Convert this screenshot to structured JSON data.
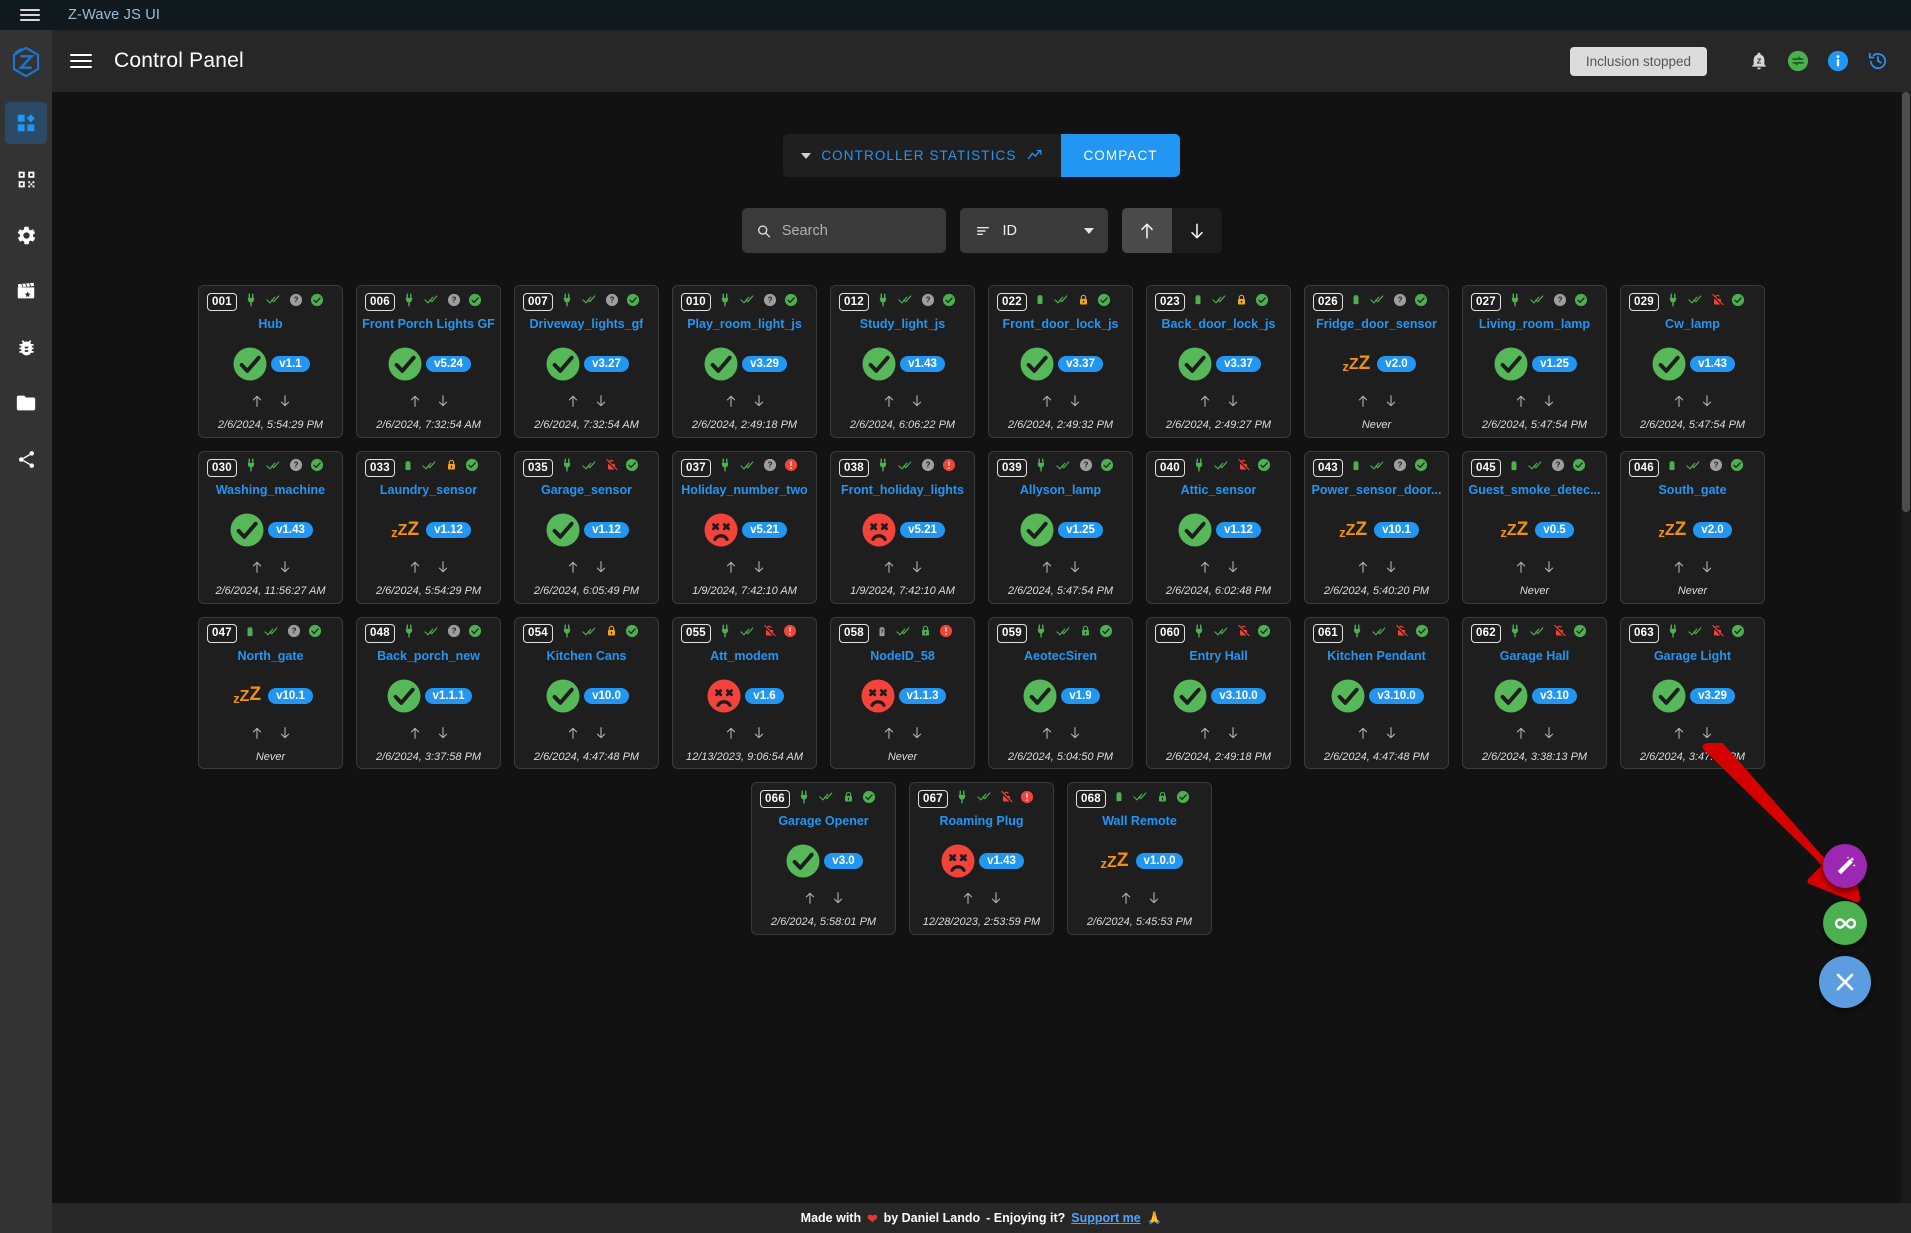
{
  "os_bar": {
    "title": "Z-Wave JS UI",
    "menu_icon": "hamburger-icon"
  },
  "appbar": {
    "title": "Control Panel",
    "inclusion_chip": "Inclusion stopped",
    "icons": [
      "zwave-bell-icon",
      "sync-icon",
      "info-icon",
      "history-icon"
    ]
  },
  "sidebar": {
    "items": [
      {
        "name": "dashboard",
        "icon": "dashboard-icon",
        "active": true
      },
      {
        "name": "qrcode",
        "icon": "qrcode-icon",
        "active": false
      },
      {
        "name": "settings",
        "icon": "gear-icon",
        "active": false
      },
      {
        "name": "scenes",
        "icon": "clapperboard-icon",
        "active": false
      },
      {
        "name": "debug",
        "icon": "bug-icon",
        "active": false
      },
      {
        "name": "store",
        "icon": "folder-icon",
        "active": false
      },
      {
        "name": "network",
        "icon": "share-icon",
        "active": false
      }
    ]
  },
  "toolbar": {
    "stats_label": "CONTROLLER STATISTICS",
    "stats_chart_icon": "trend-chart-icon",
    "compact_label": "COMPACT",
    "compact_active": true
  },
  "search": {
    "placeholder": "Search",
    "value": "",
    "icon": "search-icon",
    "sort_label": "ID",
    "sort_icon": "sort-icon",
    "asc_icon": "arrow-up-icon",
    "desc_icon": "arrow-down-icon",
    "direction_selected": "asc"
  },
  "fabs": [
    {
      "name": "magic-wand-fab",
      "icon": "magic-wand-icon",
      "color": "#9c27b0"
    },
    {
      "name": "infinity-fab",
      "icon": "infinity-icon",
      "color": "#4caf50"
    },
    {
      "name": "close-fab",
      "icon": "close-icon",
      "color": "#5c9ce0"
    }
  ],
  "annotation": {
    "name": "red-arrow-pointer",
    "color": "#d50000",
    "points_to": "infinity-fab"
  },
  "footer": {
    "made_with": "Made with",
    "heart": "❤",
    "by": "by Daniel Lando",
    "enjoying": "- Enjoying it?",
    "support_link": "Support me",
    "pray": "🙏"
  },
  "colors": {
    "accent": "#2196f3",
    "ok": "#4caf50",
    "dead": "#f44336",
    "sleep": "#f29111",
    "warn_lock": "#f5a623",
    "unknown": "#9e9e9e",
    "card_bg": "#1e1e1e",
    "page_bg": "#121212"
  },
  "nodes": [
    {
      "id": "001",
      "name": "Hub",
      "power": "plug",
      "power_color": "#4caf50",
      "ready": "double-check",
      "lock": "question",
      "lock_color": "#9e9e9e",
      "health": "check-circle",
      "health_color": "#4caf50",
      "status": "ok",
      "version": "v1.1",
      "last_seen": "2/6/2024, 5:54:29 PM"
    },
    {
      "id": "006",
      "name": "Front Porch Lights GF",
      "power": "plug",
      "power_color": "#4caf50",
      "ready": "double-check",
      "lock": "question",
      "lock_color": "#9e9e9e",
      "health": "check-circle",
      "health_color": "#4caf50",
      "status": "ok",
      "version": "v5.24",
      "last_seen": "2/6/2024, 7:32:54 AM"
    },
    {
      "id": "007",
      "name": "Driveway_lights_gf",
      "power": "plug",
      "power_color": "#4caf50",
      "ready": "double-check",
      "lock": "question",
      "lock_color": "#9e9e9e",
      "health": "check-circle",
      "health_color": "#4caf50",
      "status": "ok",
      "version": "v3.27",
      "last_seen": "2/6/2024, 7:32:54 AM"
    },
    {
      "id": "010",
      "name": "Play_room_light_js",
      "power": "plug",
      "power_color": "#4caf50",
      "ready": "double-check",
      "lock": "question",
      "lock_color": "#9e9e9e",
      "health": "check-circle",
      "health_color": "#4caf50",
      "status": "ok",
      "version": "v3.29",
      "last_seen": "2/6/2024, 2:49:18 PM"
    },
    {
      "id": "012",
      "name": "Study_light_js",
      "power": "plug",
      "power_color": "#4caf50",
      "ready": "double-check",
      "lock": "question",
      "lock_color": "#9e9e9e",
      "health": "check-circle",
      "health_color": "#4caf50",
      "status": "ok",
      "version": "v1.43",
      "last_seen": "2/6/2024, 6:06:22 PM"
    },
    {
      "id": "022",
      "name": "Front_door_lock_js",
      "power": "battery",
      "power_color": "#4caf50",
      "ready": "double-check",
      "lock": "lock",
      "lock_color": "#f5a623",
      "health": "check-circle",
      "health_color": "#4caf50",
      "status": "ok",
      "version": "v3.37",
      "last_seen": "2/6/2024, 2:49:32 PM"
    },
    {
      "id": "023",
      "name": "Back_door_lock_js",
      "power": "battery",
      "power_color": "#4caf50",
      "ready": "double-check",
      "lock": "lock",
      "lock_color": "#f5a623",
      "health": "check-circle",
      "health_color": "#4caf50",
      "status": "ok",
      "version": "v3.37",
      "last_seen": "2/6/2024, 2:49:27 PM"
    },
    {
      "id": "026",
      "name": "Fridge_door_sensor",
      "power": "battery",
      "power_color": "#4caf50",
      "ready": "double-check",
      "lock": "question",
      "lock_color": "#9e9e9e",
      "health": "check-circle",
      "health_color": "#4caf50",
      "status": "asleep",
      "version": "v2.0",
      "last_seen": "Never"
    },
    {
      "id": "027",
      "name": "Living_room_lamp",
      "power": "plug",
      "power_color": "#4caf50",
      "ready": "double-check",
      "lock": "question",
      "lock_color": "#9e9e9e",
      "health": "check-circle",
      "health_color": "#4caf50",
      "status": "ok",
      "version": "v1.25",
      "last_seen": "2/6/2024, 5:47:54 PM"
    },
    {
      "id": "029",
      "name": "Cw_lamp",
      "power": "plug",
      "power_color": "#4caf50",
      "ready": "double-check",
      "lock": "lock-off",
      "lock_color": "#f44336",
      "health": "check-circle",
      "health_color": "#4caf50",
      "status": "ok",
      "version": "v1.43",
      "last_seen": "2/6/2024, 5:47:54 PM"
    },
    {
      "id": "030",
      "name": "Washing_machine",
      "power": "plug",
      "power_color": "#4caf50",
      "ready": "double-check",
      "lock": "question",
      "lock_color": "#9e9e9e",
      "health": "check-circle",
      "health_color": "#4caf50",
      "status": "ok",
      "version": "v1.43",
      "last_seen": "2/6/2024, 11:56:27 AM"
    },
    {
      "id": "033",
      "name": "Laundry_sensor",
      "power": "battery",
      "power_color": "#4caf50",
      "ready": "double-check",
      "lock": "lock",
      "lock_color": "#f5a623",
      "health": "check-circle",
      "health_color": "#4caf50",
      "status": "asleep",
      "version": "v1.12",
      "last_seen": "2/6/2024, 5:54:29 PM"
    },
    {
      "id": "035",
      "name": "Garage_sensor",
      "power": "plug",
      "power_color": "#4caf50",
      "ready": "double-check",
      "lock": "lock-off",
      "lock_color": "#f44336",
      "health": "check-circle",
      "health_color": "#4caf50",
      "status": "ok",
      "version": "v1.12",
      "last_seen": "2/6/2024, 6:05:49 PM"
    },
    {
      "id": "037",
      "name": "Holiday_number_two",
      "power": "plug",
      "power_color": "#4caf50",
      "ready": "double-check",
      "lock": "question",
      "lock_color": "#9e9e9e",
      "health": "alert-circle",
      "health_color": "#f44336",
      "status": "dead",
      "version": "v5.21",
      "last_seen": "1/9/2024, 7:42:10 AM"
    },
    {
      "id": "038",
      "name": "Front_holiday_lights",
      "power": "plug",
      "power_color": "#4caf50",
      "ready": "double-check",
      "lock": "question",
      "lock_color": "#9e9e9e",
      "health": "alert-circle",
      "health_color": "#f44336",
      "status": "dead",
      "version": "v5.21",
      "last_seen": "1/9/2024, 7:42:10 AM"
    },
    {
      "id": "039",
      "name": "Allyson_lamp",
      "power": "plug",
      "power_color": "#4caf50",
      "ready": "double-check",
      "lock": "question",
      "lock_color": "#9e9e9e",
      "health": "check-circle",
      "health_color": "#4caf50",
      "status": "ok",
      "version": "v1.25",
      "last_seen": "2/6/2024, 5:47:54 PM"
    },
    {
      "id": "040",
      "name": "Attic_sensor",
      "power": "plug",
      "power_color": "#4caf50",
      "ready": "double-check",
      "lock": "lock-off",
      "lock_color": "#f44336",
      "health": "check-circle",
      "health_color": "#4caf50",
      "status": "ok",
      "version": "v1.12",
      "last_seen": "2/6/2024, 6:02:48 PM"
    },
    {
      "id": "043",
      "name": "Power_sensor_door...",
      "power": "battery",
      "power_color": "#4caf50",
      "ready": "double-check",
      "lock": "question",
      "lock_color": "#9e9e9e",
      "health": "check-circle",
      "health_color": "#4caf50",
      "status": "asleep",
      "version": "v10.1",
      "last_seen": "2/6/2024, 5:40:20 PM"
    },
    {
      "id": "045",
      "name": "Guest_smoke_detec...",
      "power": "battery",
      "power_color": "#4caf50",
      "ready": "double-check",
      "lock": "question",
      "lock_color": "#9e9e9e",
      "health": "check-circle",
      "health_color": "#4caf50",
      "status": "asleep",
      "version": "v0.5",
      "last_seen": "Never"
    },
    {
      "id": "046",
      "name": "South_gate",
      "power": "battery",
      "power_color": "#4caf50",
      "ready": "double-check",
      "lock": "question",
      "lock_color": "#9e9e9e",
      "health": "check-circle",
      "health_color": "#4caf50",
      "status": "asleep",
      "version": "v2.0",
      "last_seen": "Never"
    },
    {
      "id": "047",
      "name": "North_gate",
      "power": "battery",
      "power_color": "#4caf50",
      "ready": "double-check",
      "lock": "question",
      "lock_color": "#9e9e9e",
      "health": "check-circle",
      "health_color": "#4caf50",
      "status": "asleep",
      "version": "v10.1",
      "last_seen": "Never"
    },
    {
      "id": "048",
      "name": "Back_porch_new",
      "power": "plug",
      "power_color": "#4caf50",
      "ready": "double-check",
      "lock": "question",
      "lock_color": "#9e9e9e",
      "health": "check-circle",
      "health_color": "#4caf50",
      "status": "ok",
      "version": "v1.1.1",
      "last_seen": "2/6/2024, 3:37:58 PM"
    },
    {
      "id": "054",
      "name": "Kitchen Cans",
      "power": "plug",
      "power_color": "#4caf50",
      "ready": "double-check",
      "lock": "lock",
      "lock_color": "#f5a623",
      "health": "check-circle",
      "health_color": "#4caf50",
      "status": "ok",
      "version": "v10.0",
      "last_seen": "2/6/2024, 4:47:48 PM"
    },
    {
      "id": "055",
      "name": "Att_modem",
      "power": "plug",
      "power_color": "#4caf50",
      "ready": "double-check",
      "lock": "lock-off",
      "lock_color": "#f44336",
      "health": "alert-circle",
      "health_color": "#f44336",
      "status": "dead",
      "version": "v1.6",
      "last_seen": "12/13/2023, 9:06:54 AM"
    },
    {
      "id": "058",
      "name": "NodeID_58",
      "power": "battery-unknown",
      "power_color": "#9e9e9e",
      "ready": "double-check",
      "lock": "lock",
      "lock_color": "#4caf50",
      "health": "alert-circle",
      "health_color": "#f44336",
      "status": "dead",
      "version": "v1.1.3",
      "last_seen": "Never"
    },
    {
      "id": "059",
      "name": "AeotecSiren",
      "power": "plug",
      "power_color": "#4caf50",
      "ready": "double-check",
      "lock": "lock",
      "lock_color": "#4caf50",
      "health": "check-circle",
      "health_color": "#4caf50",
      "status": "ok",
      "version": "v1.9",
      "last_seen": "2/6/2024, 5:04:50 PM"
    },
    {
      "id": "060",
      "name": "Entry Hall",
      "power": "plug",
      "power_color": "#4caf50",
      "ready": "double-check",
      "lock": "lock-off",
      "lock_color": "#f44336",
      "health": "check-circle",
      "health_color": "#4caf50",
      "status": "ok",
      "version": "v3.10.0",
      "last_seen": "2/6/2024, 2:49:18 PM"
    },
    {
      "id": "061",
      "name": "Kitchen Pendant",
      "power": "plug",
      "power_color": "#4caf50",
      "ready": "double-check",
      "lock": "lock-off",
      "lock_color": "#f44336",
      "health": "check-circle",
      "health_color": "#4caf50",
      "status": "ok",
      "version": "v3.10.0",
      "last_seen": "2/6/2024, 4:47:48 PM"
    },
    {
      "id": "062",
      "name": "Garage Hall",
      "power": "plug",
      "power_color": "#4caf50",
      "ready": "double-check",
      "lock": "lock-off",
      "lock_color": "#f44336",
      "health": "check-circle",
      "health_color": "#4caf50",
      "status": "ok",
      "version": "v3.10",
      "last_seen": "2/6/2024, 3:38:13 PM"
    },
    {
      "id": "063",
      "name": "Garage Light",
      "power": "plug",
      "power_color": "#4caf50",
      "ready": "double-check",
      "lock": "lock-off",
      "lock_color": "#f44336",
      "health": "check-circle",
      "health_color": "#4caf50",
      "status": "ok",
      "version": "v3.29",
      "last_seen": "2/6/2024, 3:47:54 PM"
    },
    {
      "id": "066",
      "name": "Garage Opener",
      "power": "plug",
      "power_color": "#4caf50",
      "ready": "double-check",
      "lock": "lock",
      "lock_color": "#4caf50",
      "health": "check-circle",
      "health_color": "#4caf50",
      "status": "ok",
      "version": "v3.0",
      "last_seen": "2/6/2024, 5:58:01 PM"
    },
    {
      "id": "067",
      "name": "Roaming Plug",
      "power": "plug",
      "power_color": "#4caf50",
      "ready": "double-check",
      "lock": "lock-off",
      "lock_color": "#f44336",
      "health": "alert-circle",
      "health_color": "#f44336",
      "status": "dead",
      "version": "v1.43",
      "last_seen": "12/28/2023, 2:53:59 PM"
    },
    {
      "id": "068",
      "name": "Wall Remote",
      "power": "battery",
      "power_color": "#4caf50",
      "ready": "double-check",
      "lock": "lock",
      "lock_color": "#4caf50",
      "health": "check-circle",
      "health_color": "#4caf50",
      "status": "asleep",
      "version": "v1.0.0",
      "last_seen": "2/6/2024, 5:45:53 PM"
    }
  ]
}
